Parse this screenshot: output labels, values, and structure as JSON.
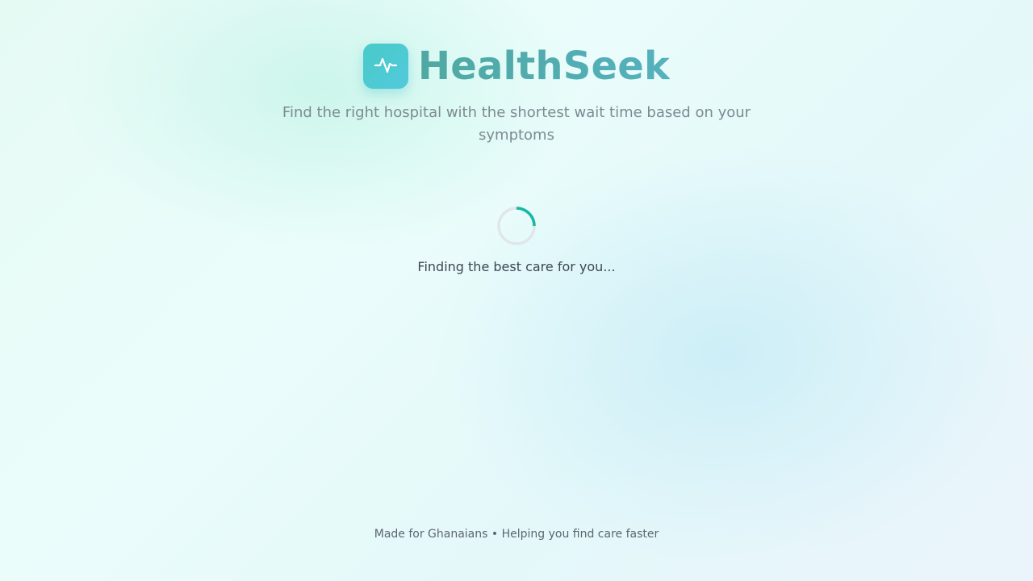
{
  "app": {
    "name": "HealthSeek",
    "logo_icon": "heartbeat-pulse-icon",
    "tagline": "Find the right hospital with the shortest wait time based on your symptoms"
  },
  "loading": {
    "spinner_icon": "loading-spinner-icon",
    "message": "Finding the best care for you..."
  },
  "footer": {
    "text": "Made for Ghanaians • Helping you find care faster"
  },
  "colors": {
    "accent": "#4ec8d0",
    "spinner": "#14b8a6",
    "brand_text": "#52aab0"
  }
}
